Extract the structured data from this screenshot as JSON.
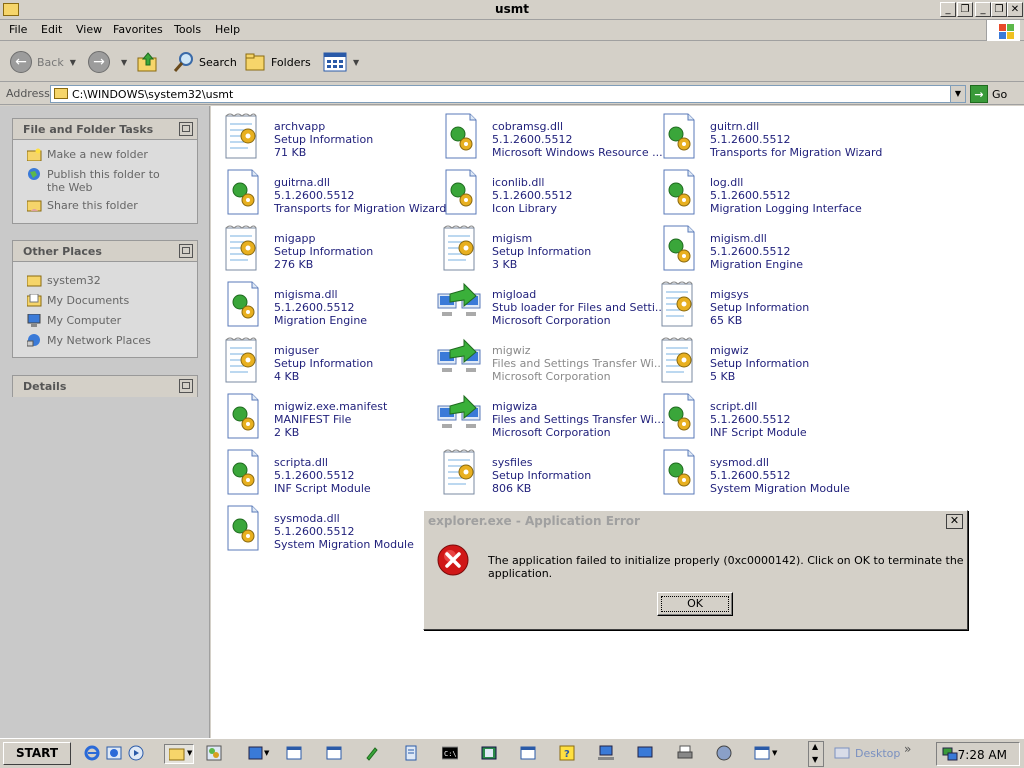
{
  "window": {
    "title": "usmt",
    "minimize": "_",
    "restore": "❐",
    "close": "✕",
    "rmin": "_",
    "rrest": "❐",
    "rclose": "✕"
  },
  "menu": [
    "File",
    "Edit",
    "View",
    "Favorites",
    "Tools",
    "Help"
  ],
  "toolbar": {
    "back": "Back",
    "search": "Search",
    "folders": "Folders"
  },
  "address": {
    "label": "Address",
    "value": "C:\\WINDOWS\\system32\\usmt",
    "go": "Go"
  },
  "left_pane": {
    "tasks_title": "File and Folder Tasks",
    "tasks": [
      "Make a new folder",
      "Publish this folder to the Web",
      "Share this folder"
    ],
    "places_title": "Other Places",
    "places": [
      "system32",
      "My Documents",
      "My Computer",
      "My Network Places"
    ],
    "details_title": "Details"
  },
  "files": [
    {
      "name": "archvapp",
      "l2": "Setup Information",
      "l3": "71 KB",
      "icon": "inf-icon"
    },
    {
      "name": "cobramsg.dll",
      "l2": "5.1.2600.5512",
      "l3": "Microsoft Windows Resource ...",
      "icon": "dll-icon"
    },
    {
      "name": "guitrn.dll",
      "l2": "5.1.2600.5512",
      "l3": "Transports for Migration Wizard",
      "icon": "dll-icon"
    },
    {
      "name": "guitrna.dll",
      "l2": "5.1.2600.5512",
      "l3": "Transports for Migration Wizard",
      "icon": "dll-icon"
    },
    {
      "name": "iconlib.dll",
      "l2": "5.1.2600.5512",
      "l3": "Icon Library",
      "icon": "dll-icon"
    },
    {
      "name": "log.dll",
      "l2": "5.1.2600.5512",
      "l3": "Migration Logging Interface",
      "icon": "dll-icon"
    },
    {
      "name": "migapp",
      "l2": "Setup Information",
      "l3": "276 KB",
      "icon": "inf-icon"
    },
    {
      "name": "migism",
      "l2": "Setup Information",
      "l3": "3 KB",
      "icon": "inf-icon"
    },
    {
      "name": "migism.dll",
      "l2": "5.1.2600.5512",
      "l3": "Migration Engine",
      "icon": "dll-icon"
    },
    {
      "name": "migisma.dll",
      "l2": "5.1.2600.5512",
      "l3": "Migration Engine",
      "icon": "dll-icon"
    },
    {
      "name": "migload",
      "l2": "Stub loader for Files and Setti...",
      "l3": "Microsoft Corporation",
      "icon": "exe-icon"
    },
    {
      "name": "migsys",
      "l2": "Setup Information",
      "l3": "65 KB",
      "icon": "inf-icon"
    },
    {
      "name": "miguser",
      "l2": "Setup Information",
      "l3": "4 KB",
      "icon": "inf-icon"
    },
    {
      "name": "migwiz",
      "l2": "Files and Settings Transfer Wi...",
      "l3": "Microsoft Corporation",
      "icon": "exe-icon",
      "dim": true
    },
    {
      "name": "migwiz",
      "l2": "Setup Information",
      "l3": "5 KB",
      "icon": "inf-icon"
    },
    {
      "name": "migwiz.exe.manifest",
      "l2": "MANIFEST File",
      "l3": "2 KB",
      "icon": "dll-icon"
    },
    {
      "name": "migwiza",
      "l2": "Files and Settings Transfer Wi...",
      "l3": "Microsoft Corporation",
      "icon": "exe-icon"
    },
    {
      "name": "script.dll",
      "l2": "5.1.2600.5512",
      "l3": "INF Script Module",
      "icon": "dll-icon"
    },
    {
      "name": "scripta.dll",
      "l2": "5.1.2600.5512",
      "l3": "INF Script Module",
      "icon": "dll-icon"
    },
    {
      "name": "sysfiles",
      "l2": "Setup Information",
      "l3": "806 KB",
      "icon": "inf-icon"
    },
    {
      "name": "sysmod.dll",
      "l2": "5.1.2600.5512",
      "l3": "System Migration Module",
      "icon": "dll-icon"
    },
    {
      "name": "sysmoda.dll",
      "l2": "5.1.2600.5512",
      "l3": "System Migration Module",
      "icon": "dll-icon"
    }
  ],
  "dialog": {
    "title": "explorer.exe - Application Error",
    "message": "The application failed to initialize properly (0xc0000142). Click on OK to terminate the application.",
    "ok": "OK",
    "close": "✕"
  },
  "taskbar": {
    "start": "START",
    "desktop": "Desktop",
    "chevron": "»",
    "time": "7:28 AM"
  },
  "colors": {
    "link": "#1f1f7a",
    "error_red": "#d01818",
    "go_green": "#3a9a3a"
  }
}
